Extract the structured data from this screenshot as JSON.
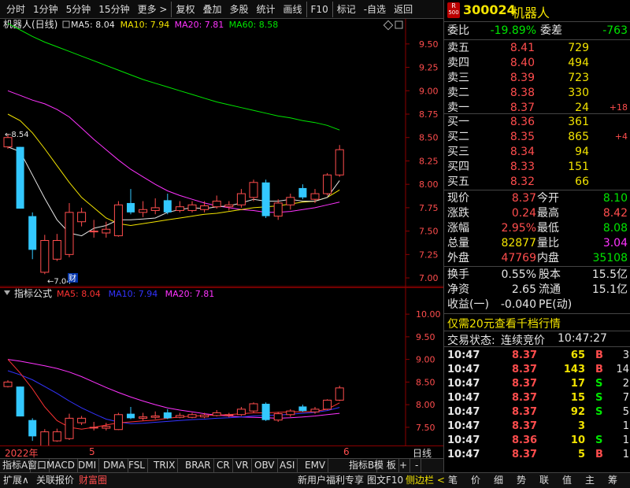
{
  "toolbar": {
    "items": [
      "分时",
      "1分钟",
      "5分钟",
      "15分钟",
      "更多 >",
      "复权",
      "叠加",
      "多股",
      "统计",
      "画线",
      "F10",
      "标记",
      "-自选",
      "返回"
    ]
  },
  "main_chart": {
    "title": "机器人(日线)",
    "ma_labels": [
      {
        "t": "MA5: 8.04",
        "c": "#e6e6e6"
      },
      {
        "t": "MA10: 7.94",
        "c": "#f2e300"
      },
      {
        "t": "MA20: 7.81",
        "c": "#ff33ff"
      },
      {
        "t": "MA60: 8.58",
        "c": "#00e600"
      }
    ],
    "yticks": [
      "9.50",
      "9.25",
      "9.00",
      "8.75",
      "8.50",
      "8.25",
      "8.00",
      "7.75",
      "7.50",
      "7.25",
      "7.00"
    ],
    "high_marker": "8.54",
    "low_marker": "7.04",
    "cai_label": "财"
  },
  "sub_chart": {
    "title": "指标公式",
    "ma_labels": [
      {
        "t": "MA5: 8.04",
        "c": "#ff3333"
      },
      {
        "t": "MA10: 7.94",
        "c": "#3333ff"
      },
      {
        "t": "MA20: 7.81",
        "c": "#ff33ff"
      }
    ],
    "yticks": [
      "10.00",
      "9.50",
      "9.00",
      "8.50",
      "8.00",
      "7.50"
    ]
  },
  "time_axis": {
    "labels": [
      "2022年",
      "5",
      "6"
    ],
    "right": "日线"
  },
  "indicator_tabs": [
    "指标A",
    "窗口",
    "MACD",
    "DMI",
    "DMA",
    "FSL",
    "TRIX",
    "BRAR",
    "CR",
    "VR",
    "OBV",
    "ASI",
    "EMV",
    "指标B",
    "模 板",
    "+",
    "-"
  ],
  "chart_data": {
    "type": "candlestick",
    "ylim": [
      6.95,
      9.65
    ],
    "candles": [
      {
        "o": 8.4,
        "c": 8.5,
        "h": 8.54,
        "l": 8.38
      },
      {
        "o": 8.4,
        "c": 7.74,
        "h": 8.4,
        "l": 7.74
      },
      {
        "o": 7.66,
        "c": 7.3,
        "h": 7.7,
        "l": 7.2
      },
      {
        "o": 7.06,
        "c": 7.4,
        "h": 7.46,
        "l": 7.04
      },
      {
        "o": 7.2,
        "c": 7.4,
        "h": 7.47,
        "l": 7.18
      },
      {
        "o": 7.25,
        "c": 7.7,
        "h": 7.8,
        "l": 7.22
      },
      {
        "o": 7.6,
        "c": 7.7,
        "h": 7.75,
        "l": 7.55
      },
      {
        "o": 7.5,
        "c": 7.5,
        "h": 7.62,
        "l": 7.43
      },
      {
        "o": 7.48,
        "c": 7.52,
        "h": 7.6,
        "l": 7.43
      },
      {
        "o": 7.45,
        "c": 7.78,
        "h": 7.82,
        "l": 7.44
      },
      {
        "o": 7.8,
        "c": 7.7,
        "h": 7.95,
        "l": 7.68
      },
      {
        "o": 7.7,
        "c": 7.73,
        "h": 7.82,
        "l": 7.65
      },
      {
        "o": 7.72,
        "c": 7.75,
        "h": 7.85,
        "l": 7.68
      },
      {
        "o": 7.83,
        "c": 7.7,
        "h": 7.9,
        "l": 7.68
      },
      {
        "o": 7.72,
        "c": 7.76,
        "h": 7.82,
        "l": 7.7
      },
      {
        "o": 7.72,
        "c": 7.78,
        "h": 7.82,
        "l": 7.7
      },
      {
        "o": 7.73,
        "c": 7.77,
        "h": 7.82,
        "l": 7.7
      },
      {
        "o": 7.76,
        "c": 7.82,
        "h": 7.88,
        "l": 7.74
      },
      {
        "o": 7.76,
        "c": 7.78,
        "h": 7.82,
        "l": 7.72
      },
      {
        "o": 7.78,
        "c": 7.9,
        "h": 7.95,
        "l": 7.75
      },
      {
        "o": 7.86,
        "c": 8.02,
        "h": 8.05,
        "l": 7.82
      },
      {
        "o": 8.02,
        "c": 7.66,
        "h": 8.05,
        "l": 7.64
      },
      {
        "o": 7.66,
        "c": 7.8,
        "h": 7.84,
        "l": 7.62
      },
      {
        "o": 7.78,
        "c": 7.86,
        "h": 7.9,
        "l": 7.73
      },
      {
        "o": 7.96,
        "c": 7.86,
        "h": 8.0,
        "l": 7.84
      },
      {
        "o": 7.84,
        "c": 7.9,
        "h": 7.95,
        "l": 7.8
      },
      {
        "o": 7.9,
        "c": 8.1,
        "h": 8.12,
        "l": 7.88
      },
      {
        "o": 8.1,
        "c": 8.37,
        "h": 8.42,
        "l": 8.08
      }
    ],
    "ma5": [
      8.4,
      8.35,
      8.1,
      7.85,
      7.62,
      7.48,
      7.45,
      7.53,
      7.56,
      7.62,
      7.62,
      7.63,
      7.64,
      7.7,
      7.73,
      7.75,
      7.74,
      7.76,
      7.77,
      7.8,
      7.84,
      7.82,
      7.82,
      7.84,
      7.82,
      7.82,
      7.86,
      8.04
    ],
    "ma10": [
      8.75,
      8.68,
      8.55,
      8.38,
      8.2,
      8.02,
      7.86,
      7.75,
      7.64,
      7.58,
      7.56,
      7.58,
      7.6,
      7.62,
      7.64,
      7.66,
      7.68,
      7.69,
      7.71,
      7.73,
      7.75,
      7.76,
      7.77,
      7.79,
      7.81,
      7.82,
      7.86,
      7.94
    ],
    "ma20": [
      9.0,
      8.95,
      8.9,
      8.86,
      8.8,
      8.72,
      8.6,
      8.48,
      8.37,
      8.26,
      8.16,
      8.08,
      8.0,
      7.93,
      7.88,
      7.84,
      7.8,
      7.77,
      7.75,
      7.73,
      7.72,
      7.7,
      7.7,
      7.71,
      7.73,
      7.75,
      7.78,
      7.81
    ],
    "ma60": [
      9.72,
      9.65,
      9.58,
      9.52,
      9.47,
      9.42,
      9.37,
      9.32,
      9.27,
      9.22,
      9.17,
      9.12,
      9.08,
      9.04,
      9.0,
      8.96,
      8.92,
      8.88,
      8.85,
      8.82,
      8.79,
      8.76,
      8.73,
      8.71,
      8.68,
      8.66,
      8.63,
      8.58
    ]
  },
  "sub_chart_data": {
    "ylim": [
      7.15,
      10.35
    ],
    "ma5": [
      9.0,
      8.7,
      8.35,
      7.95,
      7.65,
      7.5,
      7.46,
      7.5,
      7.55,
      7.6,
      7.62,
      7.64,
      7.66,
      7.7,
      7.73,
      7.75,
      7.76,
      7.77,
      7.78,
      7.8,
      7.82,
      7.82,
      7.83,
      7.84,
      7.84,
      7.85,
      7.9,
      8.04
    ],
    "ma10": [
      8.75,
      8.66,
      8.55,
      8.4,
      8.25,
      8.08,
      7.93,
      7.8,
      7.68,
      7.62,
      7.58,
      7.59,
      7.61,
      7.63,
      7.65,
      7.67,
      7.68,
      7.7,
      7.71,
      7.73,
      7.75,
      7.76,
      7.77,
      7.79,
      7.81,
      7.83,
      7.87,
      7.94
    ],
    "ma20": [
      9.0,
      8.96,
      8.91,
      8.86,
      8.8,
      8.72,
      8.62,
      8.5,
      8.38,
      8.27,
      8.17,
      8.08,
      8.0,
      7.93,
      7.88,
      7.84,
      7.8,
      7.77,
      7.75,
      7.73,
      7.72,
      7.71,
      7.7,
      7.71,
      7.73,
      7.75,
      7.78,
      7.81
    ]
  },
  "quote": {
    "badge_top": "R",
    "badge_bottom": "500",
    "code": "300024",
    "name": "机器人",
    "webi_label": "委比",
    "webi": "-19.89%",
    "wecha_label": "委差",
    "wecha": "-763",
    "sell": [
      {
        "l": "卖五",
        "p": "8.41",
        "v": "729",
        "d": ""
      },
      {
        "l": "卖四",
        "p": "8.40",
        "v": "494",
        "d": ""
      },
      {
        "l": "卖三",
        "p": "8.39",
        "v": "723",
        "d": ""
      },
      {
        "l": "卖二",
        "p": "8.38",
        "v": "330",
        "d": ""
      },
      {
        "l": "卖一",
        "p": "8.37",
        "v": "24",
        "d": "+18"
      }
    ],
    "buy": [
      {
        "l": "买一",
        "p": "8.36",
        "v": "361",
        "d": ""
      },
      {
        "l": "买二",
        "p": "8.35",
        "v": "865",
        "d": "+4"
      },
      {
        "l": "买三",
        "p": "8.34",
        "v": "94",
        "d": ""
      },
      {
        "l": "买四",
        "p": "8.33",
        "v": "151",
        "d": ""
      },
      {
        "l": "买五",
        "p": "8.32",
        "v": "66",
        "d": ""
      }
    ],
    "stats": [
      {
        "l1": "现价",
        "v1": "8.37",
        "c1": "red",
        "l2": "今开",
        "v2": "8.10",
        "c2": "green"
      },
      {
        "l1": "涨跌",
        "v1": "0.24",
        "c1": "red",
        "l2": "最高",
        "v2": "8.42",
        "c2": "red"
      },
      {
        "l1": "涨幅",
        "v1": "2.95%",
        "c1": "red",
        "l2": "最低",
        "v2": "8.08",
        "c2": "green"
      },
      {
        "l1": "总量",
        "v1": "82877",
        "c1": "yellow",
        "l2": "量比",
        "v2": "3.04",
        "c2": "mag"
      },
      {
        "l1": "外盘",
        "v1": "47769",
        "c1": "red",
        "l2": "内盘",
        "v2": "35108",
        "c2": "green"
      }
    ],
    "stats2": [
      {
        "l1": "换手",
        "v1": "0.55%",
        "l2": "股本",
        "v2": "15.5亿"
      },
      {
        "l1": "净资",
        "v1": "2.65",
        "l2": "流通",
        "v2": "15.1亿"
      },
      {
        "l1": "收益(一)",
        "v1": "-0.040",
        "l2": "PE(动)",
        "v2": ""
      }
    ],
    "promo": "仅需20元查看千档行情",
    "status_label": "交易状态:",
    "status": "连续竞价",
    "status_time": "10:47:27",
    "trades": [
      {
        "t": "10:47",
        "p": "8.37",
        "pc": "red",
        "v": "65",
        "s": "B",
        "sc": "red",
        "n": "3"
      },
      {
        "t": "10:47",
        "p": "8.37",
        "pc": "red",
        "v": "143",
        "s": "B",
        "sc": "red",
        "n": "14"
      },
      {
        "t": "10:47",
        "p": "8.37",
        "pc": "red",
        "v": "17",
        "s": "S",
        "sc": "green",
        "n": "2"
      },
      {
        "t": "10:47",
        "p": "8.37",
        "pc": "red",
        "v": "15",
        "s": "S",
        "sc": "green",
        "n": "7"
      },
      {
        "t": "10:47",
        "p": "8.37",
        "pc": "red",
        "v": "92",
        "s": "S",
        "sc": "green",
        "n": "5"
      },
      {
        "t": "10:47",
        "p": "8.37",
        "pc": "red",
        "v": "3",
        "s": "",
        "sc": "red",
        "n": "1"
      },
      {
        "t": "10:47",
        "p": "8.36",
        "pc": "red",
        "v": "10",
        "s": "S",
        "sc": "green",
        "n": "1"
      },
      {
        "t": "10:47",
        "p": "8.37",
        "pc": "red",
        "v": "5",
        "s": "B",
        "sc": "red",
        "n": "1"
      }
    ]
  },
  "bottom": {
    "left": [
      "扩展∧",
      "关联报价",
      "财富圈"
    ],
    "mid": [
      "新用户福利专享",
      "图文F10",
      "侧边栏 <"
    ],
    "right": [
      "笔",
      "价",
      "细",
      "势",
      "联",
      "值",
      "主",
      "筹"
    ]
  }
}
